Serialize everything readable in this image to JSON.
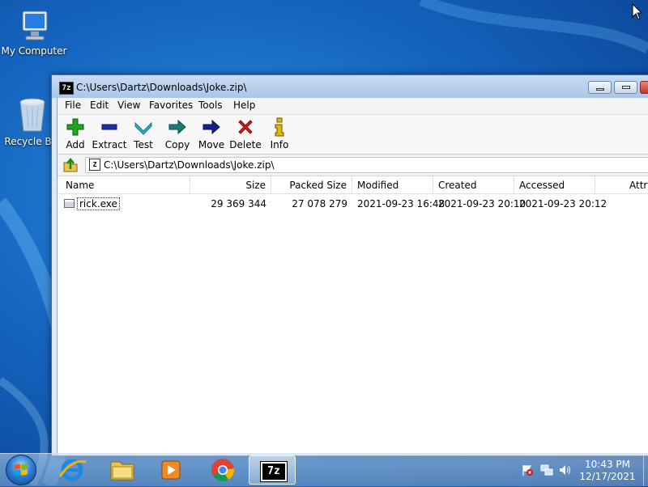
{
  "desktop": {
    "icons": [
      {
        "label": "My Computer"
      },
      {
        "label": "Recycle Bin"
      }
    ]
  },
  "window": {
    "title": "C:\\Users\\Dartz\\Downloads\\Joke.zip\\",
    "app_icon_text": "7z"
  },
  "menu": [
    "File",
    "Edit",
    "View",
    "Favorites",
    "Tools",
    "Help"
  ],
  "toolbar": {
    "buttons": [
      {
        "label": "Add",
        "icon": "plus-icon",
        "color": "#1fa51f"
      },
      {
        "label": "Extract",
        "icon": "minus-icon",
        "color": "#1e2fa8"
      },
      {
        "label": "Test",
        "icon": "check-chevron-icon",
        "color": "#27b5c7"
      },
      {
        "label": "Copy",
        "icon": "copy-arrow-icon",
        "color": "#1b7a74"
      },
      {
        "label": "Move",
        "icon": "move-arrow-icon",
        "color": "#151f8c"
      },
      {
        "label": "Delete",
        "icon": "delete-x-icon",
        "color": "#d41c1c"
      },
      {
        "label": "Info",
        "icon": "info-icon",
        "color": "#c9a000"
      }
    ]
  },
  "address": {
    "path": "C:\\Users\\Dartz\\Downloads\\Joke.zip\\",
    "icon_text": "Z"
  },
  "list": {
    "columns": [
      "Name",
      "Size",
      "Packed Size",
      "Modified",
      "Created",
      "Accessed",
      "Attributes"
    ],
    "rows": [
      {
        "name": "rick.exe",
        "size": "29 369 344",
        "packed": "27 078 279",
        "modified": "2021-09-23 16:48",
        "created": "2021-09-23 20:10",
        "accessed": "2021-09-23 20:12"
      }
    ]
  },
  "taskbar": {
    "pinned": [
      "internet-explorer-icon",
      "explorer-folder-icon",
      "media-player-icon",
      "chrome-icon",
      "7zip-icon"
    ],
    "active_app_label": "7z",
    "clock": {
      "time": "10:43 PM",
      "date": "12/17/2021"
    }
  }
}
